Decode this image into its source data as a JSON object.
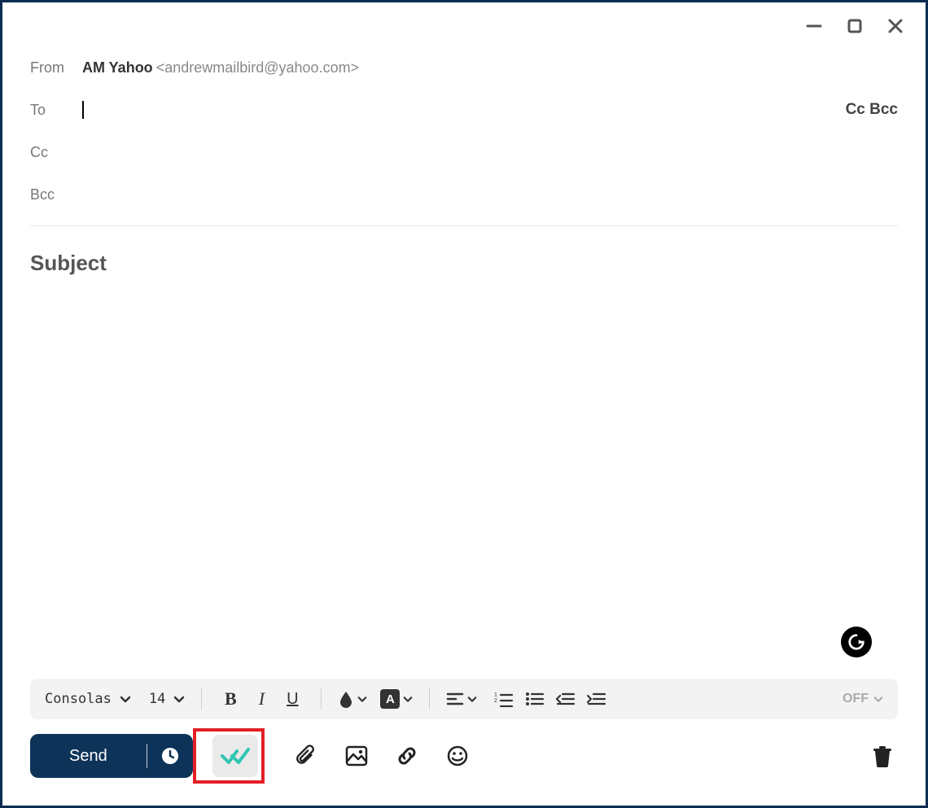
{
  "from": {
    "label": "From",
    "name": "AM Yahoo",
    "email": "<andrewmailbird@yahoo.com>"
  },
  "to": {
    "label": "To",
    "value": ""
  },
  "cc_label": "Cc",
  "bcc_label": "Bcc",
  "ccbcc_toggle": "Cc Bcc",
  "subject_placeholder": "Subject",
  "format": {
    "font": "Consolas",
    "size": "14",
    "off_label": "OFF"
  },
  "send_label": "Send"
}
